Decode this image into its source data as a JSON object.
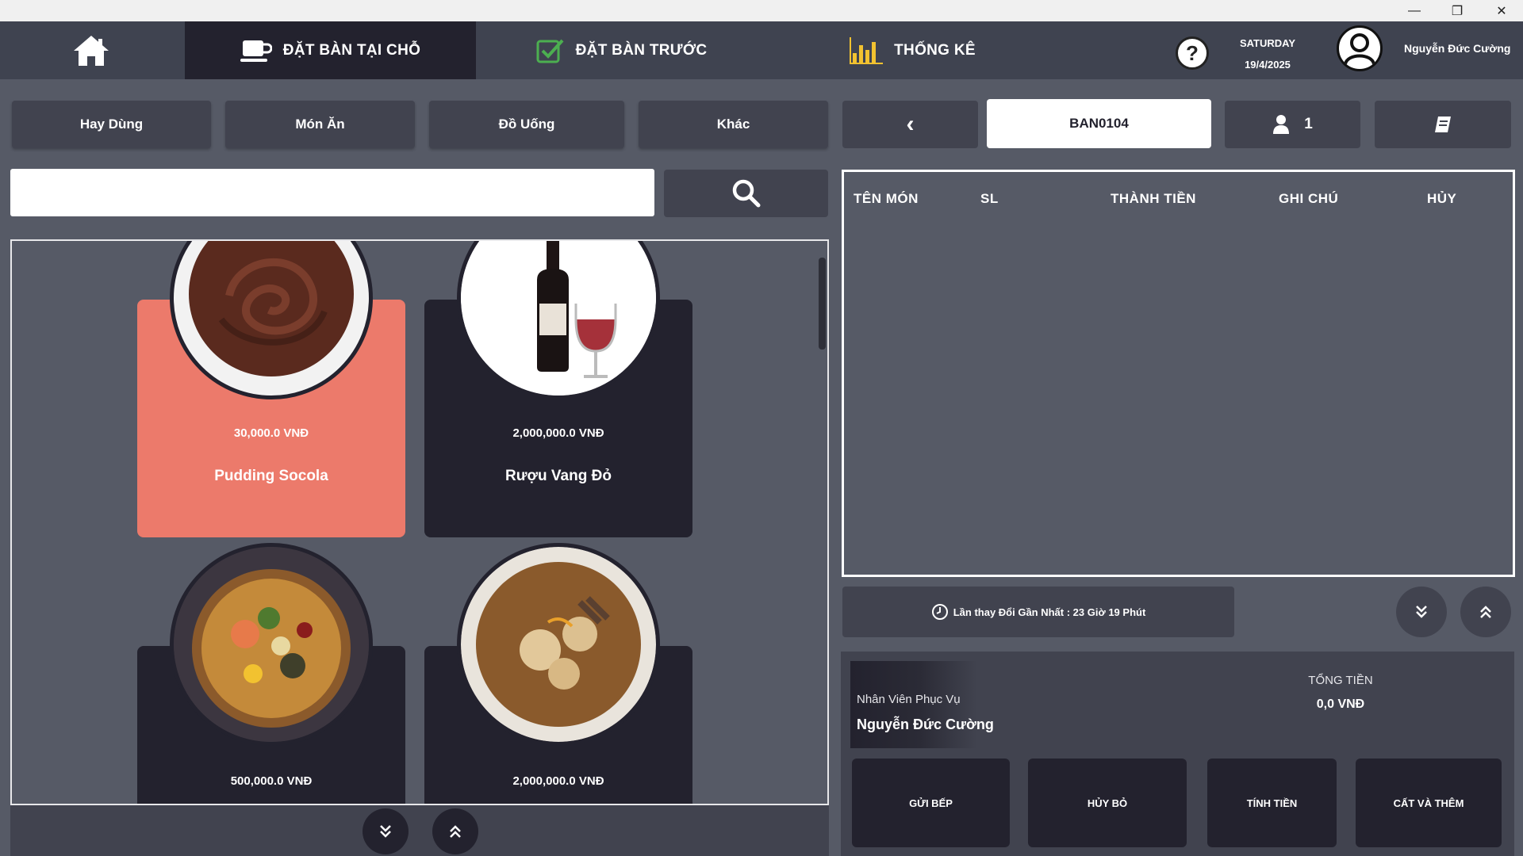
{
  "window": {
    "minimize": "—",
    "maximize": "❐",
    "close": "✕"
  },
  "nav": {
    "tabs": [
      {
        "label": "ĐẶT BÀN TẠI CHỖ"
      },
      {
        "label": "ĐẶT BÀN TRƯỚC"
      },
      {
        "label": "THỐNG KÊ"
      }
    ],
    "help": "?",
    "day": "SATURDAY",
    "date": "19/4/2025",
    "user": "Nguyễn Đức Cường"
  },
  "categories": [
    "Hay Dùng",
    "Món Ăn",
    "Đồ Uống",
    "Khác"
  ],
  "search": {
    "placeholder": "",
    "value": ""
  },
  "products": [
    {
      "price": "30,000.0 VNĐ",
      "name": "Pudding Socola"
    },
    {
      "price": "2,000,000.0 VNĐ",
      "name": "Rượu Vang Đỏ"
    },
    {
      "price": "500,000.0 VNĐ",
      "name": ""
    },
    {
      "price": "2,000,000.0 VNĐ",
      "name": ""
    }
  ],
  "order": {
    "back": "‹",
    "table_code": "BAN0104",
    "guests": "1",
    "headers": [
      "TÊN MÓN",
      "SL",
      "THÀNH TIỀN",
      "GHI CHÚ",
      "HỦY"
    ],
    "last_change": "Lần thay Đổi Gần Nhất : 23 Giờ 19 Phút"
  },
  "summary": {
    "staff_label": "Nhân Viên Phục Vụ",
    "staff_name": "Nguyễn Đức Cường",
    "total_label": "TỔNG TIỀN",
    "total_value": "0,0 VNĐ"
  },
  "actions": [
    "GỬI BẾP",
    "HỦY BỎ",
    "TÍNH TIỀN",
    "CẤT VÀ THÊM"
  ],
  "colors": {
    "nav": "#3f4350",
    "active_tab": "#23222e",
    "card": "#23222e",
    "selected_card": "#ec7a6b",
    "bg": "#565a66"
  }
}
